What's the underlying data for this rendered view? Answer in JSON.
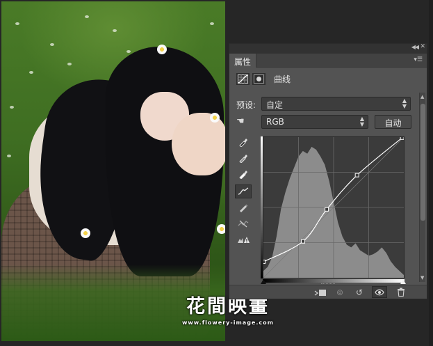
{
  "photo": {
    "description_alt": "",
    "watermark": {
      "title": "花間映畫",
      "url": "www.flowery-image.com"
    }
  },
  "panel": {
    "tab_label": "属性",
    "adjustment_title": "曲线",
    "preset_label": "预设:",
    "preset_value": "自定",
    "channel_value": "RGB",
    "auto_button": "自动",
    "curve": {
      "input_range": [
        0,
        255
      ],
      "output_range": [
        0,
        255
      ],
      "points": [
        {
          "input": 0,
          "output": 29
        },
        {
          "input": 72,
          "output": 66
        },
        {
          "input": 115,
          "output": 124
        },
        {
          "input": 170,
          "output": 186
        },
        {
          "input": 252,
          "output": 254
        }
      ]
    },
    "icons": {
      "adj_curves": "curves-adjustment-icon",
      "adj_mask": "layer-mask-icon",
      "hand_target": "on-image-adjust-icon",
      "black_point": "sample-black-point-eyedropper-icon",
      "gray_point": "sample-gray-point-eyedropper-icon",
      "white_point": "sample-white-point-eyedropper-icon",
      "curve_edit": "edit-points-curve-icon",
      "pencil": "draw-curve-pencil-icon",
      "smooth": "smooth-curve-icon",
      "clipping_warning": "clipping-warning-icon",
      "clip_to_layer": "clip-to-layer-icon",
      "view_previous": "view-previous-state-icon",
      "reset": "reset-icon",
      "visibility": "visibility-eye-icon",
      "delete": "trash-icon"
    },
    "colors": {
      "panel_bg": "#535353",
      "graph_bg": "#3b3b3b",
      "histogram": "#8c8c8c",
      "curve": "#ffffff"
    }
  }
}
